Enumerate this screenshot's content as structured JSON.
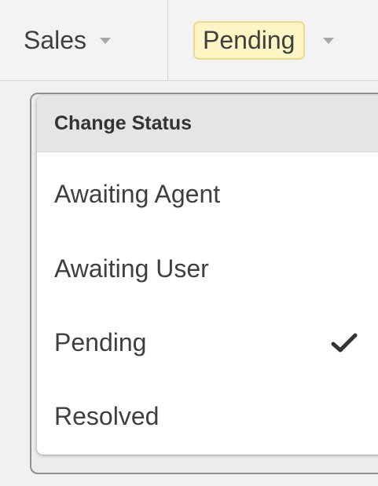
{
  "toolbar": {
    "department_label": "Sales",
    "status_label": "Pending",
    "status_highlight_color": "#fdf5c4"
  },
  "dropdown": {
    "header": "Change Status",
    "items": [
      {
        "label": "Awaiting Agent",
        "selected": false
      },
      {
        "label": "Awaiting User",
        "selected": false
      },
      {
        "label": "Pending",
        "selected": true
      },
      {
        "label": "Resolved",
        "selected": false
      }
    ],
    "selected_icon": "check-icon"
  }
}
